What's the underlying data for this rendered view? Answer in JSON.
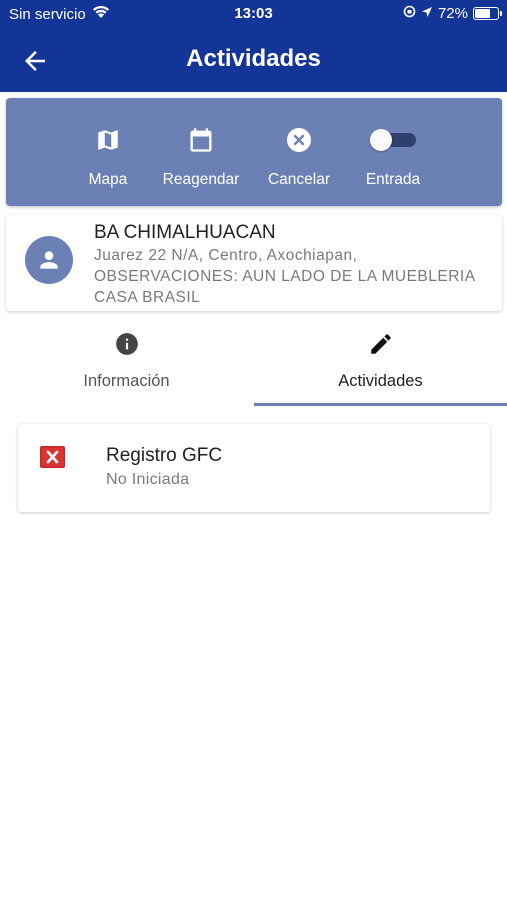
{
  "status_bar": {
    "carrier": "Sin servicio",
    "time": "13:03",
    "battery": "72%",
    "battery_level": 0.72
  },
  "header": {
    "title": "Actividades",
    "back_icon": "arrow-left-icon"
  },
  "actions": [
    {
      "label": "Mapa",
      "icon": "map-icon"
    },
    {
      "label": "Reagendar",
      "icon": "calendar-icon"
    },
    {
      "label": "Cancelar",
      "icon": "cancel-circle-icon"
    },
    {
      "label": "Entrada",
      "icon": "toggle-switch",
      "state": "off"
    }
  ],
  "contact": {
    "name": "BA CHIMALHUACAN",
    "address": "Juarez 22 N/A, Centro, Axochiapan, OBSERVACIONES: AUN LADO DE LA MUEBLERIA CASA BRASIL",
    "avatar_icon": "person-icon"
  },
  "tabs": [
    {
      "label": "Información",
      "icon": "info-icon",
      "selected": false
    },
    {
      "label": "Actividades",
      "icon": "pencil-icon",
      "selected": true
    }
  ],
  "activities": [
    {
      "title": "Registro GFC",
      "status": "No Iniciada",
      "icon": "red-x-icon"
    }
  ],
  "colors": {
    "primary": "#123597",
    "panel": "#6b80b5",
    "accent_red": "#c62828"
  }
}
